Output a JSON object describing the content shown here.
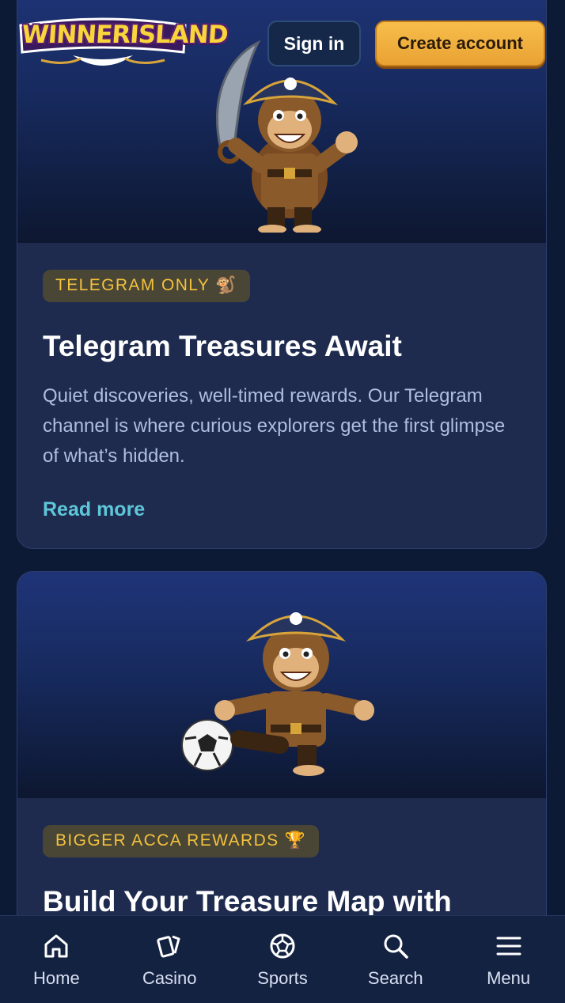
{
  "header": {
    "logo_text": "WINNERISLAND",
    "signin_label": "Sign in",
    "create_account_label": "Create account"
  },
  "promos": [
    {
      "badge": "TELEGRAM ONLY 🐒",
      "title": "Telegram Treasures Await",
      "description": "Quiet discoveries, well-timed rewards. Our Telegram channel is where curious explorers get the first glimpse of what’s hidden.",
      "link_label": "Read more",
      "image_icon": "pirate-monkey-sword-icon"
    },
    {
      "badge": "BIGGER ACCA REWARDS 🏆",
      "title": "Build Your Treasure Map with",
      "image_icon": "pirate-monkey-football-icon"
    }
  ],
  "nav": [
    {
      "label": "Home",
      "icon": "home-icon"
    },
    {
      "label": "Casino",
      "icon": "cards-icon"
    },
    {
      "label": "Sports",
      "icon": "football-icon"
    },
    {
      "label": "Search",
      "icon": "search-icon"
    },
    {
      "label": "Menu",
      "icon": "hamburger-icon"
    }
  ],
  "colors": {
    "background": "#0d1a36",
    "card": "#1e2b4e",
    "badge_text": "#f3c13c",
    "link": "#5ec6d8",
    "create_button": "#f0ae3e"
  }
}
